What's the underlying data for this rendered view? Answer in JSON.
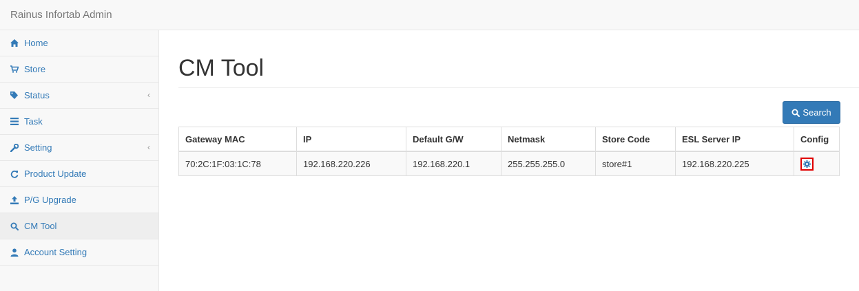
{
  "app": {
    "brand": "Rainus Infortab Admin"
  },
  "sidebar": {
    "items": [
      {
        "label": "Home",
        "icon": "home-icon"
      },
      {
        "label": "Store",
        "icon": "cart-icon"
      },
      {
        "label": "Status",
        "icon": "tags-icon",
        "expandable": true
      },
      {
        "label": "Task",
        "icon": "list-icon"
      },
      {
        "label": "Setting",
        "icon": "wrench-icon",
        "expandable": true
      },
      {
        "label": "Product Update",
        "icon": "refresh-icon"
      },
      {
        "label": "P/G Upgrade",
        "icon": "upload-icon"
      },
      {
        "label": "CM Tool",
        "icon": "search-icon",
        "active": true
      },
      {
        "label": "Account Setting",
        "icon": "user-icon"
      }
    ]
  },
  "main": {
    "title": "CM Tool",
    "search_label": "Search",
    "table": {
      "columns": [
        "Gateway MAC",
        "IP",
        "Default G/W",
        "Netmask",
        "Store Code",
        "ESL Server IP",
        "Config"
      ],
      "rows": [
        [
          "70:2C:1F:03:1C:78",
          "192.168.220.226",
          "192.168.220.1",
          "255.255.255.0",
          "store#1",
          "192.168.220.225"
        ]
      ]
    }
  },
  "colors": {
    "link": "#337ab7",
    "highlight": "#e00000"
  }
}
